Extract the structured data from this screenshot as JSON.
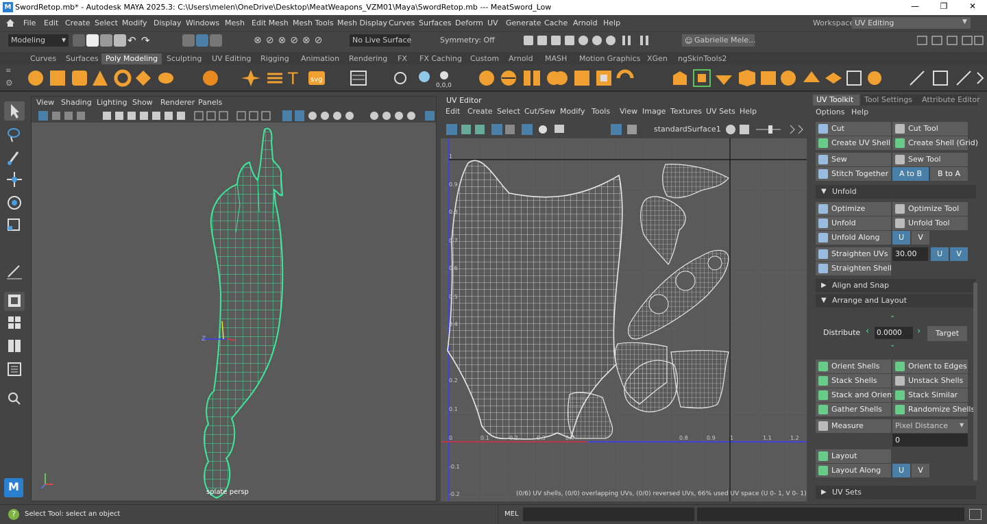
{
  "window": {
    "title": "SwordRetop.mb* - Autodesk MAYA 2025.3: C:\\Users\\melen\\OneDrive\\Desktop\\MeatWeapons_VZM01\\Maya\\SwordRetop.mb   ---   MeatSword_Low",
    "logo": "M"
  },
  "menu": [
    "File",
    "Edit",
    "Create",
    "Select",
    "Modify",
    "Display",
    "Windows",
    "Mesh",
    "Edit Mesh",
    "Mesh Tools",
    "Mesh Display",
    "Curves",
    "Surfaces",
    "Deform",
    "UV",
    "Generate",
    "Cache",
    "Arnold",
    "Help"
  ],
  "workspace": {
    "label": "Workspace:",
    "value": "UV Editing"
  },
  "status": {
    "mode": "Modeling",
    "live_surface": "No Live Surface",
    "symmetry": "Symmetry: Off",
    "user": "Gabrielle Mele..."
  },
  "shelf_tabs": [
    "Curves",
    "Surfaces",
    "Poly Modeling",
    "Sculpting",
    "UV Editing",
    "Rigging",
    "Animation",
    "Rendering",
    "FX",
    "FX Caching",
    "Custom",
    "Arnold",
    "MASH",
    "Motion Graphics",
    "XGen",
    "ngSkinTools2"
  ],
  "shelf_active": "Poly Modeling",
  "shelf_extra": {
    "svg_label": "svg",
    "text_label": "T",
    "coord": "0,0,0"
  },
  "viewport": {
    "menu": [
      "View",
      "Shading",
      "Lighting",
      "Show",
      "Renderer",
      "Panels"
    ],
    "camera_label": "persp",
    "camera_prefix": "splate",
    "axis_label_z": "Z"
  },
  "uv_editor": {
    "title": "UV Editor",
    "menu": [
      "Edit",
      "Create",
      "Select",
      "Cut/Sew",
      "Modify",
      "Tools",
      "View",
      "Image",
      "Textures",
      "UV Sets",
      "Help"
    ],
    "material": "standardSurface1",
    "ticks_x": [
      "0",
      "0.1",
      "0.2",
      "0.3",
      "0.4",
      "0.8",
      "0.9",
      "1",
      "1.1",
      "1.2"
    ],
    "ticks_y": [
      "1",
      "0.9",
      "0.8",
      "0.7",
      "0.6",
      "0.5",
      "0.4",
      "0.2",
      "0.1",
      "-0.1",
      "-0.2"
    ],
    "info": "(0/6) UV shells, (0/0) overlapping UVs, (0/0) reversed UVs, 66% used UV space (U  0- 1, V  0- 1)"
  },
  "toolkit": {
    "tabs": [
      "UV Toolkit",
      "Tool Settings",
      "Attribute Editor"
    ],
    "menu": [
      "Options",
      "Help"
    ],
    "cut": "Cut",
    "cut_tool": "Cut Tool",
    "create_uv_shell": "Create UV Shell",
    "create_shell_grid": "Create Shell (Grid)",
    "sew": "Sew",
    "sew_tool": "Sew Tool",
    "stitch_together": "Stitch Together",
    "a_to_b": "A to B",
    "b_to_a": "B to A",
    "unfold_section": "Unfold",
    "optimize": "Optimize",
    "optimize_tool": "Optimize Tool",
    "unfold": "Unfold",
    "unfold_tool": "Unfold Tool",
    "unfold_along": "Unfold Along",
    "u": "U",
    "v": "V",
    "straighten_uvs": "Straighten UVs",
    "straighten_value": "30.00",
    "straighten_shell": "Straighten Shell",
    "align_snap": "Align and Snap",
    "arrange_layout": "Arrange and Layout",
    "distribute": "Distribute",
    "distribute_value": "0.0000",
    "target": "Target",
    "orient_shells": "Orient Shells",
    "orient_to_edges": "Orient to Edges",
    "stack_shells": "Stack Shells",
    "unstack_shells": "Unstack Shells",
    "stack_and_orient": "Stack and Orient",
    "stack_similar": "Stack Similar",
    "gather_shells": "Gather Shells",
    "randomize_shells": "Randomize Shells",
    "measure": "Measure",
    "pixel_distance": "Pixel Distance",
    "measure_value": "0",
    "layout": "Layout",
    "layout_along": "Layout Along",
    "uv_sets": "UV Sets"
  },
  "bottom": {
    "help_text": "Select Tool: select an object",
    "mel": "MEL"
  },
  "colors": {
    "accent": "#4a7fa8",
    "mesh": "#3ee89a",
    "uv_lines": "#e8e8e8"
  }
}
